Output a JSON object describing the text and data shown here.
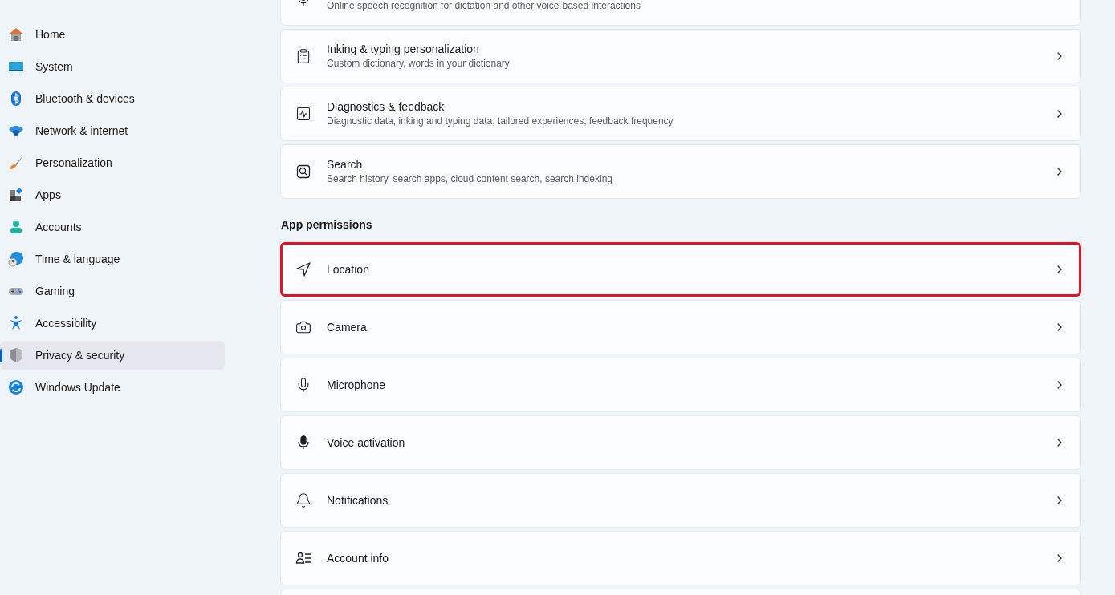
{
  "sidebar": {
    "items": [
      {
        "label": "Home",
        "selected": false
      },
      {
        "label": "System",
        "selected": false
      },
      {
        "label": "Bluetooth & devices",
        "selected": false
      },
      {
        "label": "Network & internet",
        "selected": false
      },
      {
        "label": "Personalization",
        "selected": false
      },
      {
        "label": "Apps",
        "selected": false
      },
      {
        "label": "Accounts",
        "selected": false
      },
      {
        "label": "Time & language",
        "selected": false
      },
      {
        "label": "Gaming",
        "selected": false
      },
      {
        "label": "Accessibility",
        "selected": false
      },
      {
        "label": "Privacy & security",
        "selected": true
      },
      {
        "label": "Windows Update",
        "selected": false
      }
    ]
  },
  "settings": [
    {
      "description": "Online speech recognition for dictation and other voice-based interactions",
      "highlighted": false
    },
    {
      "title": "Inking & typing personalization",
      "description": "Custom dictionary, words in your dictionary",
      "highlighted": false
    },
    {
      "title": "Diagnostics & feedback",
      "description": "Diagnostic data, inking and typing data, tailored experiences, feedback frequency",
      "highlighted": false
    },
    {
      "title": "Search",
      "description": "Search history, search apps, cloud content search, search indexing",
      "highlighted": false
    }
  ],
  "app_permissions": {
    "heading": "App permissions",
    "items": [
      {
        "title": "Location",
        "highlighted": true
      },
      {
        "title": "Camera",
        "highlighted": false
      },
      {
        "title": "Microphone",
        "highlighted": false
      },
      {
        "title": "Voice activation",
        "highlighted": false
      },
      {
        "title": "Notifications",
        "highlighted": false
      },
      {
        "title": "Account info",
        "highlighted": false
      },
      {
        "highlighted": false
      }
    ]
  }
}
